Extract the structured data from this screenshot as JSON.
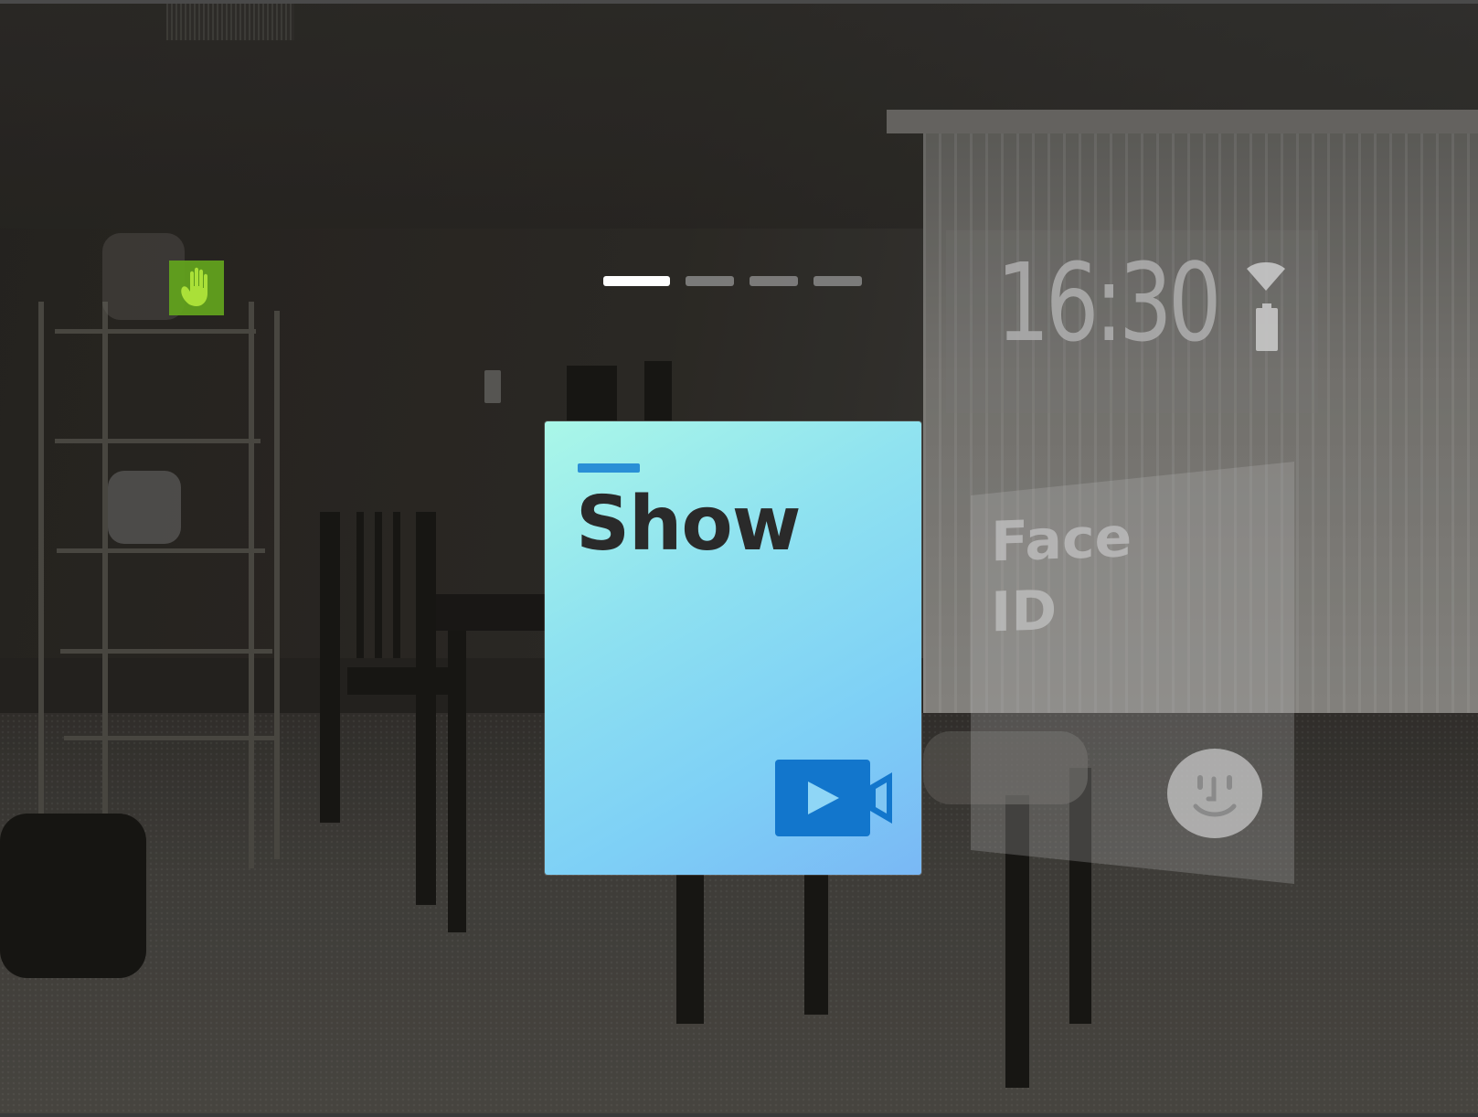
{
  "status_bar": {
    "time": "16:30",
    "wifi_icon": "wifi-icon",
    "battery_icon": "battery-icon"
  },
  "page_indicator": {
    "count": 4,
    "active_index": 0
  },
  "gesture_indicator": {
    "icon": "hand-stop-icon",
    "color": "#63a51d"
  },
  "cards": {
    "show": {
      "title": "Show",
      "icon": "video-play-icon",
      "accent_color": "#2a8fd6",
      "gradient_start": "#aaf7e8",
      "gradient_end": "#7ab8f5"
    },
    "face_id": {
      "title_line1": "Face",
      "title_line2": "ID",
      "icon": "face-icon"
    }
  },
  "background": {
    "description_colors": {
      "wall": "#34312c",
      "floor": "#4c4a45"
    }
  }
}
